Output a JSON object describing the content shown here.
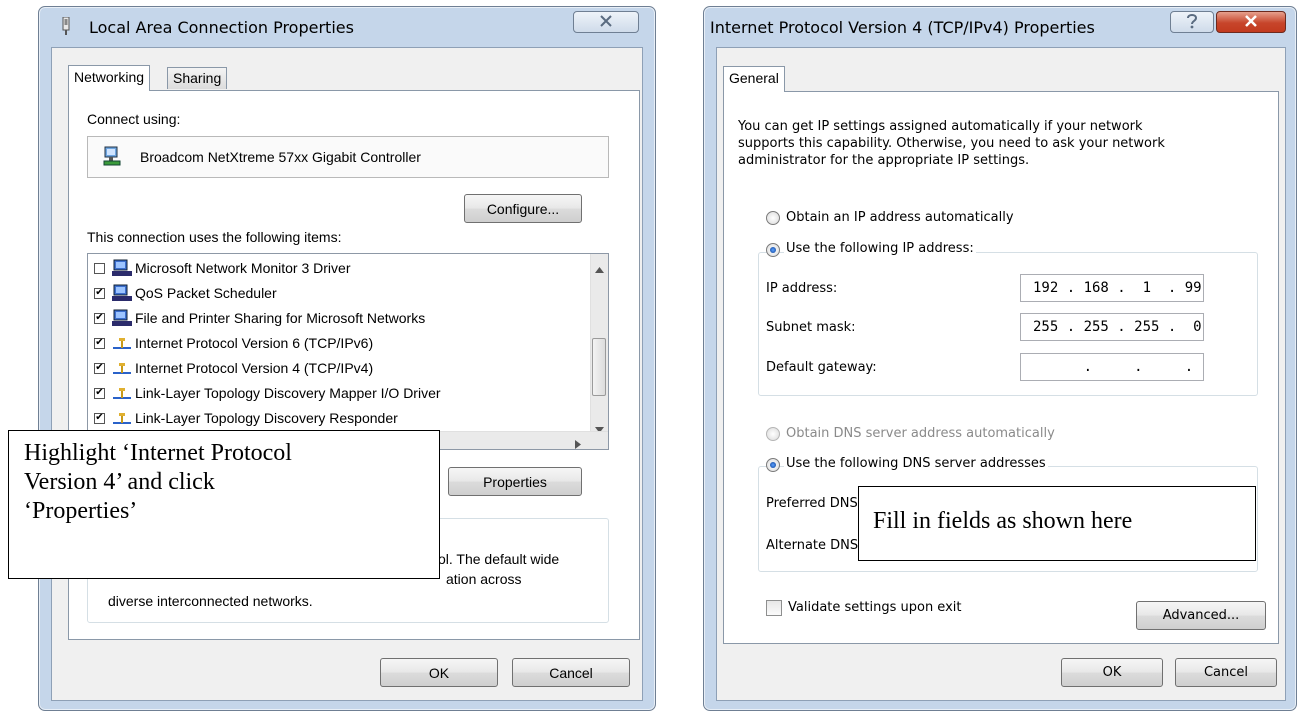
{
  "left_window": {
    "title": "Local Area Connection Properties",
    "tabs": [
      {
        "label": "Networking"
      },
      {
        "label": "Sharing"
      }
    ],
    "connect_using_label": "Connect using:",
    "adapter_name": "Broadcom NetXtreme 57xx Gigabit Controller",
    "configure_button": "Configure...",
    "items_label": "This connection uses the following items:",
    "items": [
      {
        "label": "Microsoft Network Monitor 3 Driver",
        "checked": false,
        "icon": "network-client-icon"
      },
      {
        "label": "QoS Packet Scheduler",
        "checked": true,
        "icon": "network-client-icon"
      },
      {
        "label": "File and Printer Sharing for Microsoft Networks",
        "checked": true,
        "icon": "network-client-icon"
      },
      {
        "label": "Internet Protocol Version 6 (TCP/IPv6)",
        "checked": true,
        "icon": "protocol-icon"
      },
      {
        "label": "Internet Protocol Version 4 (TCP/IPv4)",
        "checked": true,
        "icon": "protocol-icon"
      },
      {
        "label": "Link-Layer Topology Discovery Mapper I/O Driver",
        "checked": true,
        "icon": "protocol-icon"
      },
      {
        "label": "Link-Layer Topology Discovery Responder",
        "checked": true,
        "icon": "protocol-icon"
      }
    ],
    "properties_button": "Properties",
    "description_line1": "ol. The default wide",
    "description_line2": "ation across",
    "description_line3": "diverse interconnected networks.",
    "ok_button": "OK",
    "cancel_button": "Cancel"
  },
  "right_window": {
    "title": "Internet Protocol Version 4 (TCP/IPv4) Properties",
    "tab": "General",
    "intro_line1": "You can get IP settings assigned automatically if your network",
    "intro_line2": "supports this capability. Otherwise, you need to ask your network",
    "intro_line3": "administrator for the appropriate IP settings.",
    "obtain_ip_auto": "Obtain an IP address automatically",
    "use_following_ip": "Use the following IP address:",
    "ip_label": "IP address:",
    "ip_value": "192 . 168 .  1  . 99",
    "subnet_label": "Subnet mask:",
    "subnet_value": "255 . 255 . 255 .  0",
    "gateway_label": "Default gateway:",
    "gateway_value": "      .     .     .",
    "obtain_dns_auto": "Obtain DNS server address automatically",
    "use_following_dns": "Use the following DNS server addresses",
    "preferred_dns_label": "Preferred DNS",
    "alternate_dns_label": "Alternate DNS",
    "validate_label": "Validate settings upon exit",
    "advanced_button": "Advanced...",
    "ok_button": "OK",
    "cancel_button": "Cancel"
  },
  "callouts": {
    "left_line1": "Highlight ‘Internet Protocol",
    "left_line2": "Version 4’ and click",
    "left_line3": "‘Properties’",
    "right": "Fill in fields as shown here"
  },
  "colors": {
    "frame": "#c5d6ea",
    "close_red": "#c7452b",
    "highlight_text": "#000000"
  }
}
